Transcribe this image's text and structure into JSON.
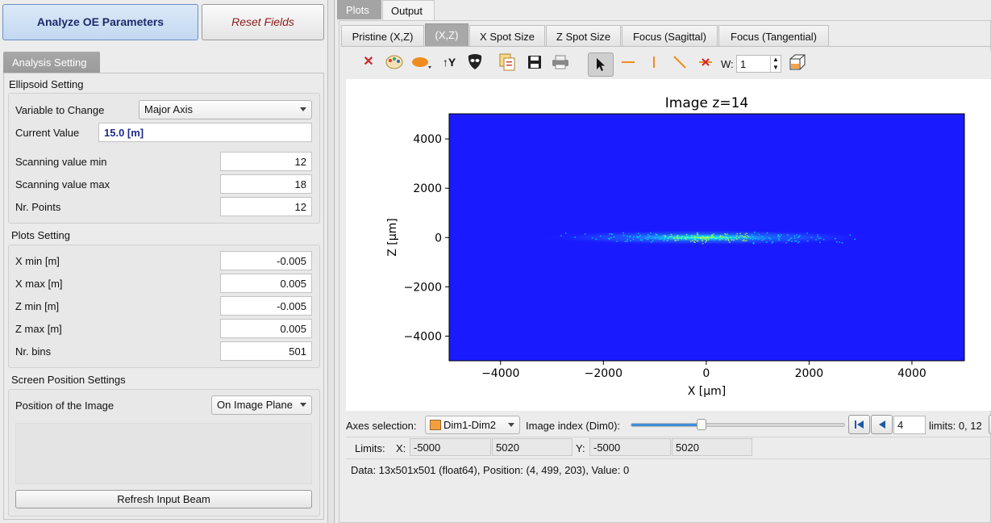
{
  "top_buttons": {
    "analyze": "Analyze OE Parameters",
    "reset": "Reset Fields"
  },
  "left_tab": "Analysis Setting",
  "ellipsoid": {
    "title": "Ellipsoid Setting",
    "variable_label": "Variable to Change",
    "variable_value": "Major Axis",
    "current_label": "Current Value",
    "current_value": "15.0 [m]",
    "scan_min_label": "Scanning value min",
    "scan_min": "12",
    "scan_max_label": "Scanning value max",
    "scan_max": "18",
    "npoints_label": "Nr. Points",
    "npoints": "12"
  },
  "plots_setting": {
    "title": "Plots Setting",
    "xmin_label": "X min [m]",
    "xmin": "-0.005",
    "xmax_label": "X max [m]",
    "xmax": "0.005",
    "zmin_label": "Z min [m]",
    "zmin": "-0.005",
    "zmax_label": "Z max [m]",
    "zmax": "0.005",
    "nbins_label": "Nr. bins",
    "nbins": "501"
  },
  "screen": {
    "title": "Screen Position Settings",
    "position_label": "Position of the Image",
    "position_value": "On Image Plane",
    "refresh_button": "Refresh Input Beam"
  },
  "main_tabs": [
    "Plots",
    "Output"
  ],
  "sub_tabs": [
    "Pristine (X,Z)",
    "(X,Z)",
    "X Spot Size",
    "Z Spot Size",
    "Focus (Sagittal)",
    "Focus (Tangential)"
  ],
  "toolbar": {
    "width_label": "W:",
    "width_value": "1",
    "icons": [
      "reset-zoom-icon",
      "colormap-icon",
      "ellipse-icon",
      "y-axis-icon",
      "mask-icon",
      "copy-icon",
      "save-icon",
      "print-icon",
      "pointer-icon",
      "hline-icon",
      "vline-icon",
      "diagonal-line-icon",
      "no-line-icon"
    ]
  },
  "colors": {
    "field_bg": "#1a1aff",
    "beam_mid": "#00e5ff",
    "beam_core": "#b8ff40"
  },
  "chart_data": {
    "type": "heatmap",
    "title": "Image z=14",
    "xlabel": "X [μm]",
    "ylabel": "Z [μm]",
    "xlim": [
      -5000,
      5020
    ],
    "ylim": [
      -5000,
      5020
    ],
    "xticks": [
      "−4000",
      "−2000",
      "0",
      "2000",
      "4000"
    ],
    "yticks": [
      "4000",
      "2000",
      "0",
      "−2000",
      "−4000"
    ],
    "xtick_values": [
      -4000,
      -2000,
      0,
      2000,
      4000
    ],
    "ytick_values": [
      4000,
      2000,
      0,
      -2000,
      -4000
    ],
    "beam": {
      "center_x": 0,
      "center_z": 0,
      "half_width_x": 3300,
      "half_height_z": 200
    }
  },
  "axes_selection": {
    "label": "Axes selection:",
    "value": "Dim1-Dim2"
  },
  "image_index": {
    "label": "Image index (Dim0):",
    "value": "4",
    "limits": "limits: 0, 12",
    "slider_fraction": 0.33
  },
  "limits": {
    "label": "Limits:",
    "x_label": "X:",
    "x_min": "-5000",
    "x_max": "5020",
    "y_label": "Y:",
    "y_min": "-5000",
    "y_max": "5020"
  },
  "status": "Data: 13x501x501 (float64), Position: (4, 499, 203), Value: 0"
}
